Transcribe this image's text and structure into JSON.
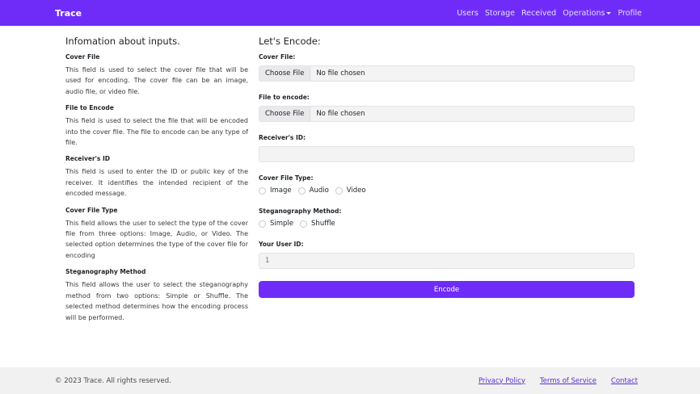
{
  "navbar": {
    "brand": "Trace",
    "links": [
      "Users",
      "Storage",
      "Received",
      "Operations",
      "Profile"
    ]
  },
  "info": {
    "heading": "Infomation about inputs.",
    "items": [
      {
        "title": "Cover File",
        "text": "This field is used to select the cover file that will be used for encoding. The cover file can be an image, audio file, or video file."
      },
      {
        "title": "File to Encode",
        "text": "This field is used to select the file that will be encoded into the cover file. The file to encode can be any type of file."
      },
      {
        "title": "Receiver's ID",
        "text": "This field is used to enter the ID or public key of the receiver. It identifies the intended recipient of the encoded message."
      },
      {
        "title": "Cover File Type",
        "text": "This field allows the user to select the type of the cover file from three options: Image, Audio, or Video. The selected option determines the type of the cover file for encoding"
      },
      {
        "title": "Steganography Method",
        "text": "This field allows the user to select the steganography method from two options: Simple or Shuffle. The selected method determines how the encoding process will be performed."
      }
    ]
  },
  "form": {
    "heading": "Let's Encode:",
    "cover_file_label": "Cover File:",
    "file_to_encode_label": "File to encode:",
    "choose_file": "Choose File",
    "no_file": "No file chosen",
    "receiver_label": "Receiver's ID:",
    "receiver_value": "",
    "cover_type_label": "Cover File Type:",
    "cover_types": [
      "Image",
      "Audio",
      "Video"
    ],
    "method_label": "Steganography Method:",
    "methods": [
      "Simple",
      "Shuffle"
    ],
    "user_id_label": "Your User ID:",
    "user_id_value": "1",
    "encode_button": "Encode"
  },
  "footer": {
    "copyright": "© 2023 Trace. All rights reserved.",
    "links": [
      "Privacy Policy",
      "Terms of Service",
      "Contact"
    ]
  },
  "colors": {
    "accent": "#6f2cf9",
    "footer_bg": "#f1f1f2"
  }
}
